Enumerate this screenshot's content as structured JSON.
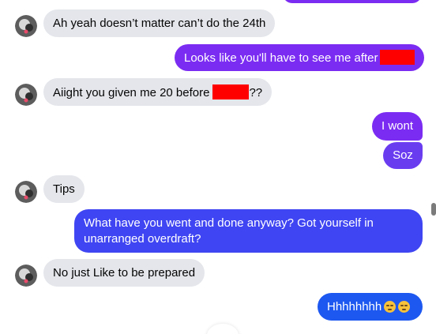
{
  "colors": {
    "incoming_bubble": "#e4e6eb",
    "outgoing_purple": "#7b2cf2",
    "outgoing_violet": "#6a3cf0",
    "outgoing_blue": "#3f45f2",
    "outgoing_bright_blue": "#1d58f0",
    "redaction": "#ff0000",
    "emoji": "#f7c23a"
  },
  "messages": [
    {
      "id": "m1",
      "direction": "incoming",
      "text": "Ah yeah doesn’t matter can’t do the 24th"
    },
    {
      "id": "m2",
      "direction": "outgoing",
      "text": "Looks like you'll have to see me after",
      "redacted_after": true
    },
    {
      "id": "m3",
      "direction": "incoming",
      "text": "Aiight you given me 20 before",
      "redacted_after": true,
      "suffix": "??"
    },
    {
      "id": "m4",
      "direction": "outgoing",
      "text": "I wont"
    },
    {
      "id": "m5",
      "direction": "outgoing",
      "text": "Soz"
    },
    {
      "id": "m6",
      "direction": "incoming",
      "text": "Tips"
    },
    {
      "id": "m7",
      "direction": "outgoing",
      "lines": [
        "What have you went and done anyway? Got yourself in",
        "unarranged overdraft?"
      ]
    },
    {
      "id": "m8",
      "direction": "incoming",
      "text": "No just Like to be prepared"
    },
    {
      "id": "m9",
      "direction": "outgoing",
      "text": "Hhhhhhhh",
      "emoji": [
        "unamused-face-icon",
        "unamused-face-icon"
      ]
    }
  ],
  "icons": {
    "avatar": "contact-avatar-icon",
    "emoji": "unamused-face-icon"
  }
}
